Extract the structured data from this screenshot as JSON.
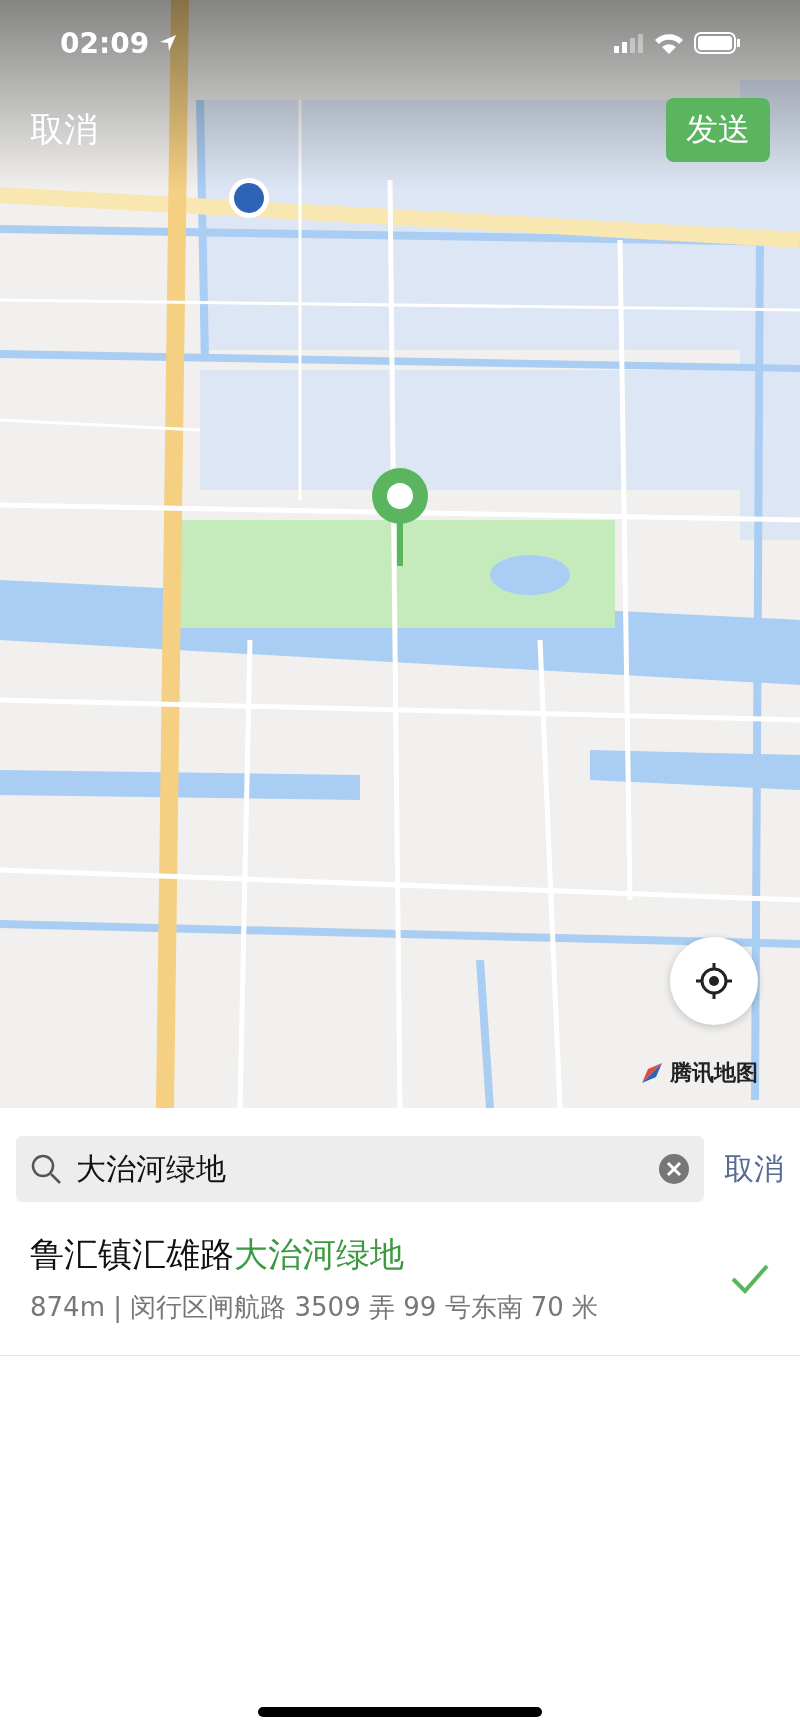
{
  "status_bar": {
    "time": "02:09"
  },
  "header": {
    "cancel": "取消",
    "send": "发送"
  },
  "map": {
    "attribution": "腾讯地图"
  },
  "search": {
    "value": "大治河绿地",
    "cancel": "取消"
  },
  "results": [
    {
      "name": "鲁汇镇汇雄路",
      "match": "大治河绿地",
      "address": "874m | 闵行区闸航路 3509 弄 99 号东南 70 米",
      "selected": true
    }
  ]
}
